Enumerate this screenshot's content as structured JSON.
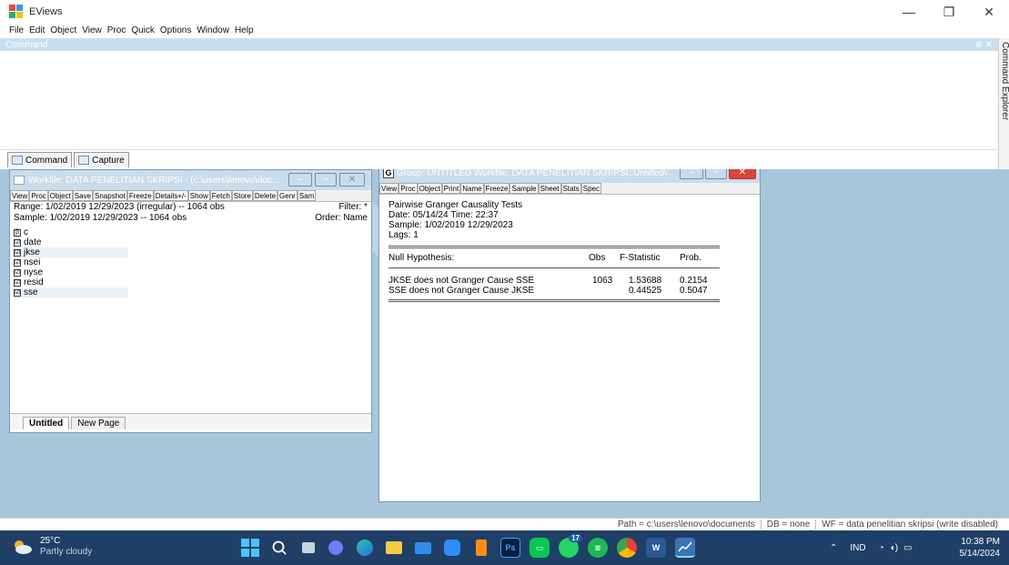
{
  "app": {
    "title": "EViews"
  },
  "window_controls": {
    "minimize": "—",
    "restore": "❐",
    "close": "✕"
  },
  "menu": [
    "File",
    "Edit",
    "Object",
    "View",
    "Proc",
    "Quick",
    "Options",
    "Window",
    "Help"
  ],
  "command": {
    "header": "Command",
    "header_controls": "⊕ ✕",
    "tabs": [
      "Command",
      "Capture"
    ],
    "explorer_label": "Command Explorer"
  },
  "workfile": {
    "title": "Workfile: DATA PENELITIAN SKRIPSI - (c:\\users\\lenovo\\doc...",
    "toolbar": [
      "View",
      "Proc",
      "Object",
      "Save",
      "Snapshot",
      "Freeze",
      "Details+/-",
      "Show",
      "Fetch",
      "Store",
      "Delete",
      "Genr",
      "Sam"
    ],
    "range": "Range:  1/02/2019 12/29/2023 (irregular)  --  1064 obs",
    "filter": "Filter: *",
    "sample": "Sample: 1/02/2019 12/29/2023  --  1064 obs",
    "order": "Order: Name",
    "items": [
      {
        "icon": "β",
        "name": "c",
        "selected": false
      },
      {
        "icon": "☑",
        "name": "date",
        "selected": false
      },
      {
        "icon": "☑",
        "name": "jkse",
        "selected": true
      },
      {
        "icon": "☑",
        "name": "nsei",
        "selected": false
      },
      {
        "icon": "☑",
        "name": "nyse",
        "selected": false
      },
      {
        "icon": "☑",
        "name": "resid",
        "selected": false
      },
      {
        "icon": "☑",
        "name": "sse",
        "selected": true
      }
    ],
    "pages": [
      "Untitled",
      "New Page"
    ]
  },
  "group": {
    "icon": "G",
    "title": "Group: UNTITLED   Workfile: DATA PENELITIAN SKRIPSI::Untitled\\",
    "toolbar": [
      "View",
      "Proc",
      "Object",
      "Print",
      "Name",
      "Freeze",
      "Sample",
      "Sheet",
      "Stats",
      "Spec"
    ],
    "lines": [
      "Pairwise Granger Causality Tests",
      "Date: 05/14/24   Time: 22:37",
      "Sample: 1/02/2019 12/29/2023",
      "Lags: 1"
    ],
    "table": {
      "headers": [
        "Null Hypothesis:",
        "Obs",
        "F-Statistic",
        "Prob."
      ],
      "rows": [
        [
          "JKSE does not Granger Cause SSE",
          "1063",
          "1.53688",
          "0.2154"
        ],
        [
          "SSE does not Granger Cause JKSE",
          "",
          "0.44525",
          "0.5047"
        ]
      ]
    }
  },
  "status": {
    "path": "Path = c:\\users\\lenovo\\documents",
    "db": "DB = none",
    "wf": "WF = data penelitian skripsi (write disabled)"
  },
  "taskbar": {
    "weather_temp": "25°C",
    "weather_desc": "Partly cloudy",
    "language": "IND",
    "time": "10:38 PM",
    "date": "5/14/2024",
    "badge": "17"
  }
}
